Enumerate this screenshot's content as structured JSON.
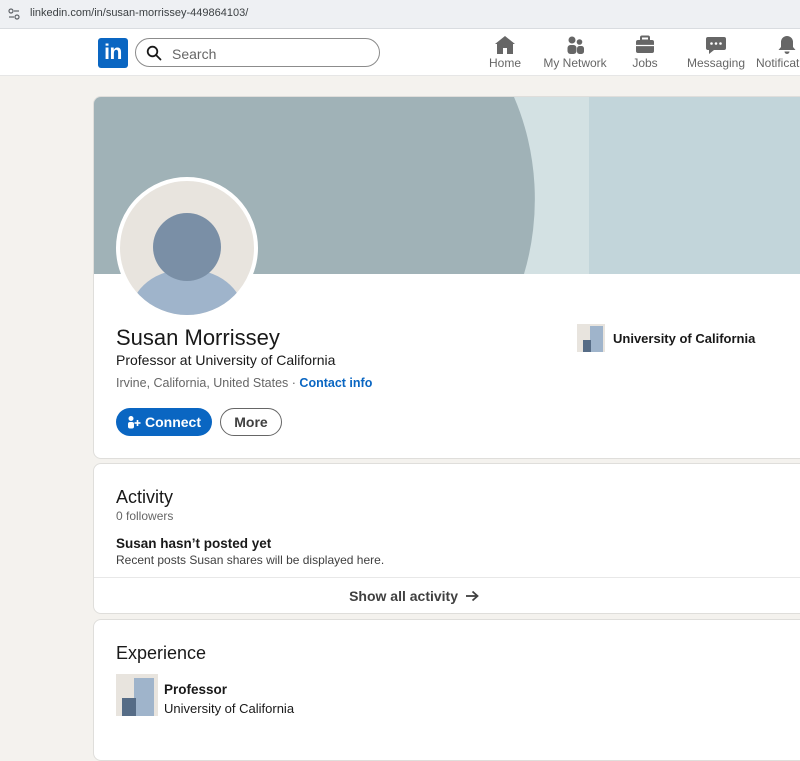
{
  "browser": {
    "url": "linkedin.com/in/susan-morrissey-449864103/"
  },
  "nav": {
    "logo_text": "in",
    "search_placeholder": "Search",
    "items": [
      {
        "label": "Home",
        "icon": "home-icon"
      },
      {
        "label": "My Network",
        "icon": "network-icon"
      },
      {
        "label": "Jobs",
        "icon": "briefcase-icon"
      },
      {
        "label": "Messaging",
        "icon": "message-icon"
      },
      {
        "label": "Notifications",
        "icon": "bell-icon"
      }
    ]
  },
  "profile": {
    "name": "Susan Morrissey",
    "headline": "Professor at University of California",
    "location": "Irvine, California, United States",
    "separator": " · ",
    "contact_link": "Contact info",
    "connect_label": "Connect",
    "more_label": "More",
    "organization": "University of California"
  },
  "activity": {
    "title": "Activity",
    "followers": "0 followers",
    "empty_title": "Susan hasn’t posted yet",
    "empty_desc": "Recent posts Susan shares will be displayed here.",
    "show_all": "Show all activity"
  },
  "experience": {
    "title": "Experience",
    "items": [
      {
        "role": "Professor",
        "org": "University of California"
      }
    ]
  },
  "colors": {
    "brand": "#0a66c2",
    "banner": "#c2d5da",
    "banner_dark": "#a0b2b7"
  }
}
